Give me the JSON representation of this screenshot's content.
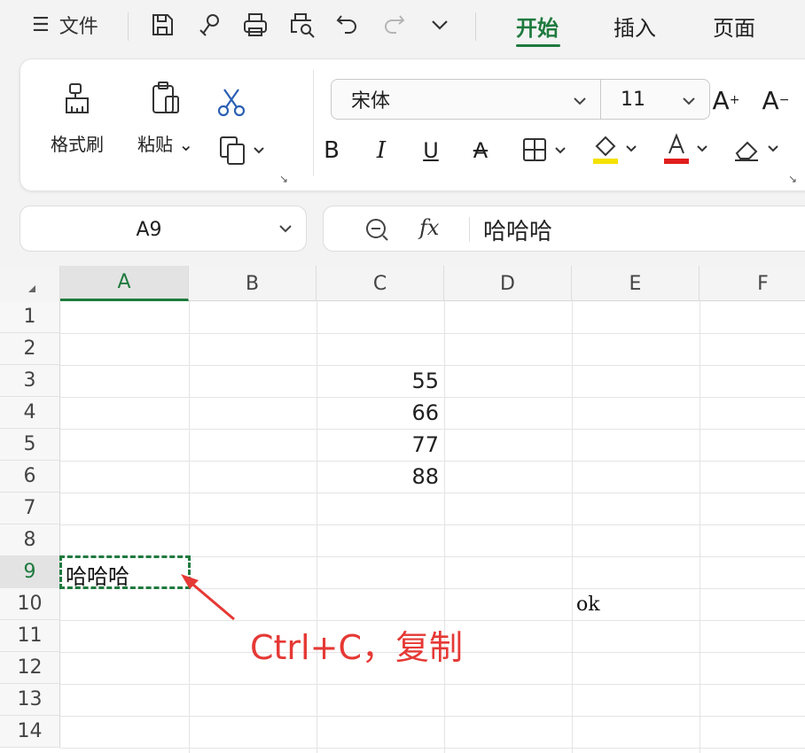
{
  "menu": {
    "file_label": "文件",
    "hamburger": "☰"
  },
  "quick_icons": [
    "save-icon",
    "link-icon",
    "print-icon",
    "print-preview-icon",
    "undo-icon",
    "redo-icon",
    "chevron-down-icon"
  ],
  "tabs": [
    {
      "label": "开始",
      "active": true
    },
    {
      "label": "插入",
      "active": false
    },
    {
      "label": "页面",
      "active": false
    }
  ],
  "ribbon": {
    "format_painter_label": "格式刷",
    "paste_label": "粘贴",
    "font_name": "宋体",
    "font_size": "11",
    "increase_font": "A",
    "decrease_font": "A",
    "bold": "B",
    "italic": "I",
    "underline": "U",
    "strike": "A",
    "font_color_letter": "A"
  },
  "colors": {
    "accent": "#1e7a3e",
    "highlight": "#f5e100",
    "font_red": "#e01e1e",
    "annotation": "#e53935"
  },
  "name_box": {
    "value": "A9"
  },
  "formula_bar": {
    "fx": "fx",
    "content": "哈哈哈"
  },
  "sheet": {
    "columns": [
      "A",
      "B",
      "C",
      "D",
      "E",
      "F"
    ],
    "rows": [
      "1",
      "2",
      "3",
      "4",
      "5",
      "6",
      "7",
      "8",
      "9",
      "10",
      "11",
      "12",
      "13",
      "14"
    ],
    "selected_column": "A",
    "selected_row": "9",
    "cells": {
      "C3": "55",
      "C4": "66",
      "C5": "77",
      "C6": "88",
      "A9": "哈哈哈",
      "E10": "ok"
    }
  },
  "annotation": {
    "text": "Ctrl+C，复制"
  }
}
